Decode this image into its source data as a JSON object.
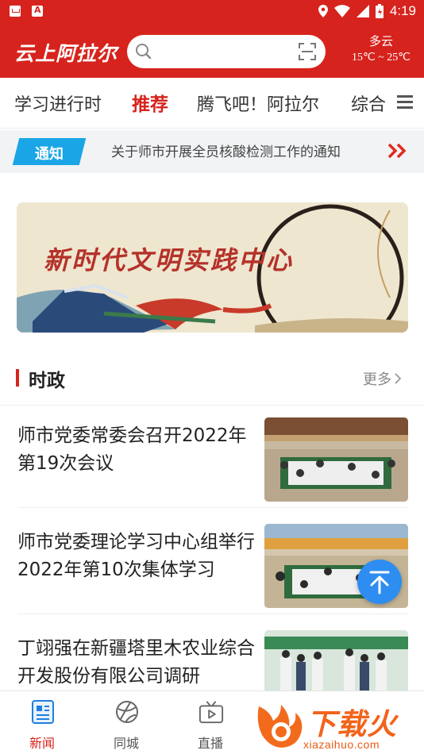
{
  "status_bar": {
    "time": "4:19"
  },
  "header": {
    "app_title": "云上阿拉尔",
    "weather_condition": "多云",
    "weather_temp": "15℃ ~ 25℃"
  },
  "tabs": [
    {
      "label": "学习进行时"
    },
    {
      "label": "推荐"
    },
    {
      "label": "腾飞吧！阿拉尔"
    },
    {
      "label": "综合"
    }
  ],
  "notice": {
    "badge": "通知",
    "text": "关于师市开展全员核酸检测工作的通知"
  },
  "banner": {
    "title": "新时代文明实践中心"
  },
  "section": {
    "title": "时政",
    "more": "更多"
  },
  "news": [
    {
      "title": "师市党委常委会召开2022年第19次会议"
    },
    {
      "title": "师市党委理论学习中心组举行2022年第10次集体学习"
    },
    {
      "title": "丁翊强在新疆塔里木农业综合开发股份有限公司调研"
    }
  ],
  "bottom_nav": [
    {
      "label": "新闻",
      "icon": "news-icon",
      "active": true
    },
    {
      "label": "同城",
      "icon": "city-icon"
    },
    {
      "label": "直播",
      "icon": "tv-icon"
    }
  ],
  "watermark": {
    "text": "下载火",
    "sub": "xiazaihuo.com"
  },
  "colors": {
    "brand_red": "#d7231d",
    "notice_blue": "#1aa6e6",
    "fab_blue": "#2d8df0"
  }
}
